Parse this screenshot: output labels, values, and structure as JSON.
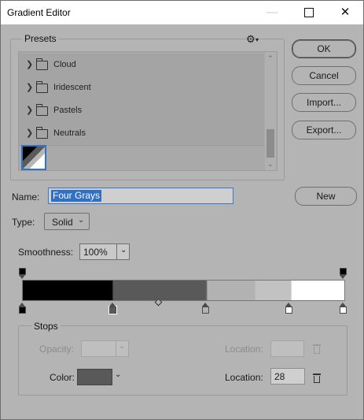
{
  "window": {
    "title": "Gradient Editor",
    "minimize": "—",
    "close": "✕"
  },
  "presets": {
    "label": "Presets",
    "gear": "⚙",
    "gear_caret": "▾",
    "items": [
      {
        "label": "Cloud"
      },
      {
        "label": "Iridescent"
      },
      {
        "label": "Pastels"
      },
      {
        "label": "Neutrals"
      }
    ],
    "chevron": "❯",
    "scroll_up": "⌃",
    "scroll_down": "⌄"
  },
  "buttons": {
    "ok": "OK",
    "cancel": "Cancel",
    "import": "Import...",
    "export": "Export...",
    "new": "New"
  },
  "name": {
    "label": "Name:",
    "value": "Four Grays"
  },
  "type": {
    "label": "Type:",
    "value": "Solid",
    "arrow": "⌄"
  },
  "smoothness": {
    "label": "Smoothness:",
    "value": "100%",
    "arrow": "⌄"
  },
  "gradient": {
    "color_stops": [
      {
        "location": 0,
        "color": "#000000"
      },
      {
        "location": 28,
        "color": "#595959",
        "selected": true
      },
      {
        "location": 57,
        "color": "#b2b2b2"
      },
      {
        "location": 83,
        "color": "#ffffff"
      },
      {
        "location": 100,
        "color": "#ffffff"
      }
    ],
    "opacity_stops": [
      {
        "location": 0,
        "opacity": 100
      },
      {
        "location": 100,
        "opacity": 100
      }
    ],
    "midpoint": 50
  },
  "stops": {
    "label": "Stops",
    "opacity_label": "Opacity:",
    "opacity_arrow": "⌄",
    "location_label": "Location:",
    "color_label": "Color:",
    "color_value": "#595959",
    "color_arrow": "⌄",
    "color_location": "28"
  }
}
